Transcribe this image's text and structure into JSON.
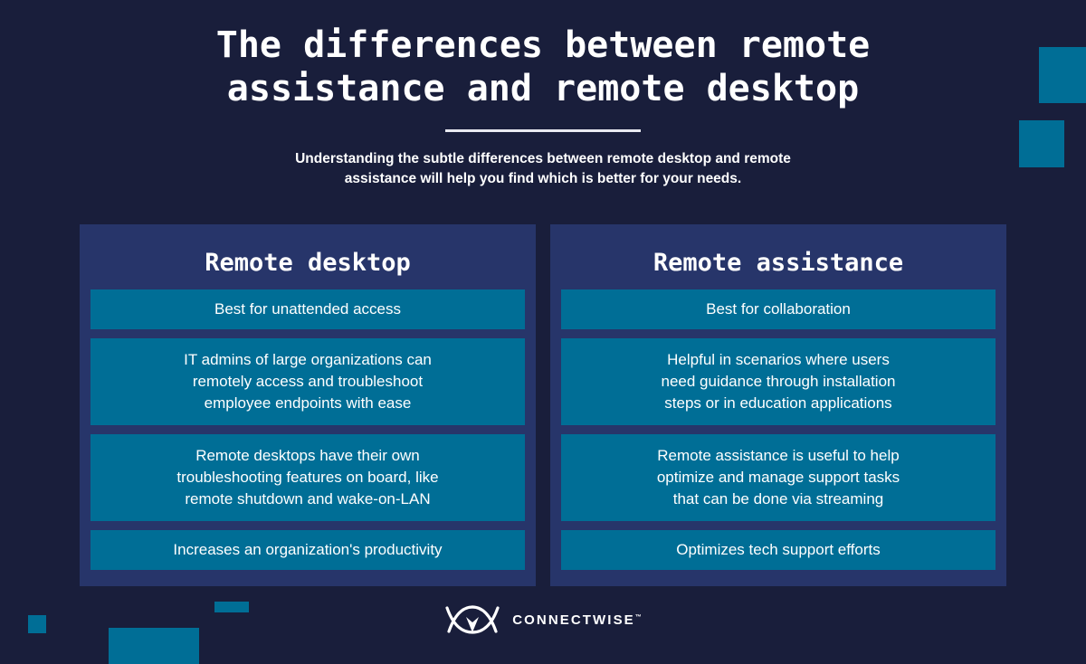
{
  "header": {
    "title_lines": [
      "The differences between remote",
      "assistance and remote desktop"
    ],
    "subtitle_lines": [
      "Understanding the subtle differences between remote desktop and remote",
      "assistance will help you find which is better for your needs."
    ]
  },
  "columns": [
    {
      "title": "Remote desktop",
      "cards": [
        {
          "lines": [
            "Best for unattended access"
          ]
        },
        {
          "lines": [
            "IT admins of large organizations can",
            "remotely access and troubleshoot",
            "employee endpoints with ease"
          ]
        },
        {
          "lines": [
            "Remote desktops have their own",
            "troubleshooting features on board, like",
            "remote shutdown and wake-on-LAN"
          ]
        },
        {
          "lines": [
            "Increases an organization's productivity"
          ]
        }
      ]
    },
    {
      "title": "Remote assistance",
      "cards": [
        {
          "lines": [
            "Best for collaboration"
          ]
        },
        {
          "lines": [
            "Helpful in scenarios where users",
            "need guidance through installation",
            "steps or in education applications"
          ]
        },
        {
          "lines": [
            "Remote assistance is useful to help",
            "optimize and manage support tasks",
            "that can be done via streaming"
          ]
        },
        {
          "lines": [
            "Optimizes tech support efforts"
          ]
        }
      ]
    }
  ],
  "footer": {
    "brand": "CONNECTWISE",
    "trademark": "™",
    "logo_icon": "connectwise-logo-icon"
  },
  "colors": {
    "background": "#191e3b",
    "panel": "#27356a",
    "accent_teal": "#006e96",
    "text": "#ffffff"
  }
}
